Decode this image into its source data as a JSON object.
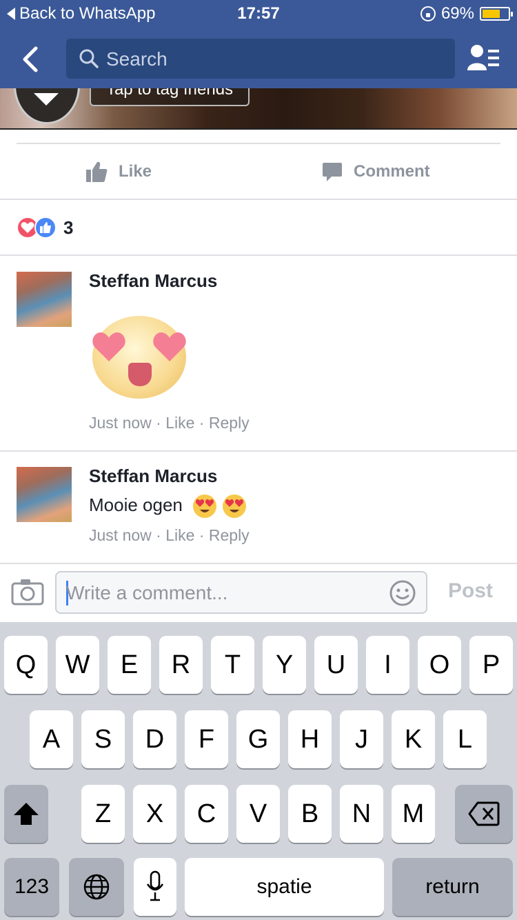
{
  "status_bar": {
    "back_app": "Back to WhatsApp",
    "time": "17:57",
    "battery_pct": "69%",
    "battery_level": 0.69
  },
  "nav": {
    "search_placeholder": "Search"
  },
  "photo": {
    "tag_text": "Tap to tag friends"
  },
  "actions": {
    "like_label": "Like",
    "comment_label": "Comment"
  },
  "reactions": {
    "count": "3"
  },
  "comments": [
    {
      "name": "Steffan Marcus",
      "text": "",
      "time": "Just now",
      "like": "Like",
      "reply": "Reply",
      "sticker": "heart-eyes-sticker"
    },
    {
      "name": "Steffan Marcus",
      "text": "Mooie ogen",
      "time": "Just now",
      "like": "Like",
      "reply": "Reply",
      "emoji": [
        "heart-eyes-emoji",
        "heart-eyes-emoji"
      ]
    }
  ],
  "composer": {
    "placeholder": "Write a comment...",
    "post_label": "Post"
  },
  "keyboard": {
    "row1": [
      "Q",
      "W",
      "E",
      "R",
      "T",
      "Y",
      "U",
      "I",
      "O",
      "P"
    ],
    "row2": [
      "A",
      "S",
      "D",
      "F",
      "G",
      "H",
      "J",
      "K",
      "L"
    ],
    "row3": [
      "Z",
      "X",
      "C",
      "V",
      "B",
      "N",
      "M"
    ],
    "numbers": "123",
    "space": "spatie",
    "return": "return"
  },
  "colors": {
    "header": "#3b5998",
    "battery": "#f7c600",
    "love": "#f25268",
    "like": "#4a88f5"
  }
}
